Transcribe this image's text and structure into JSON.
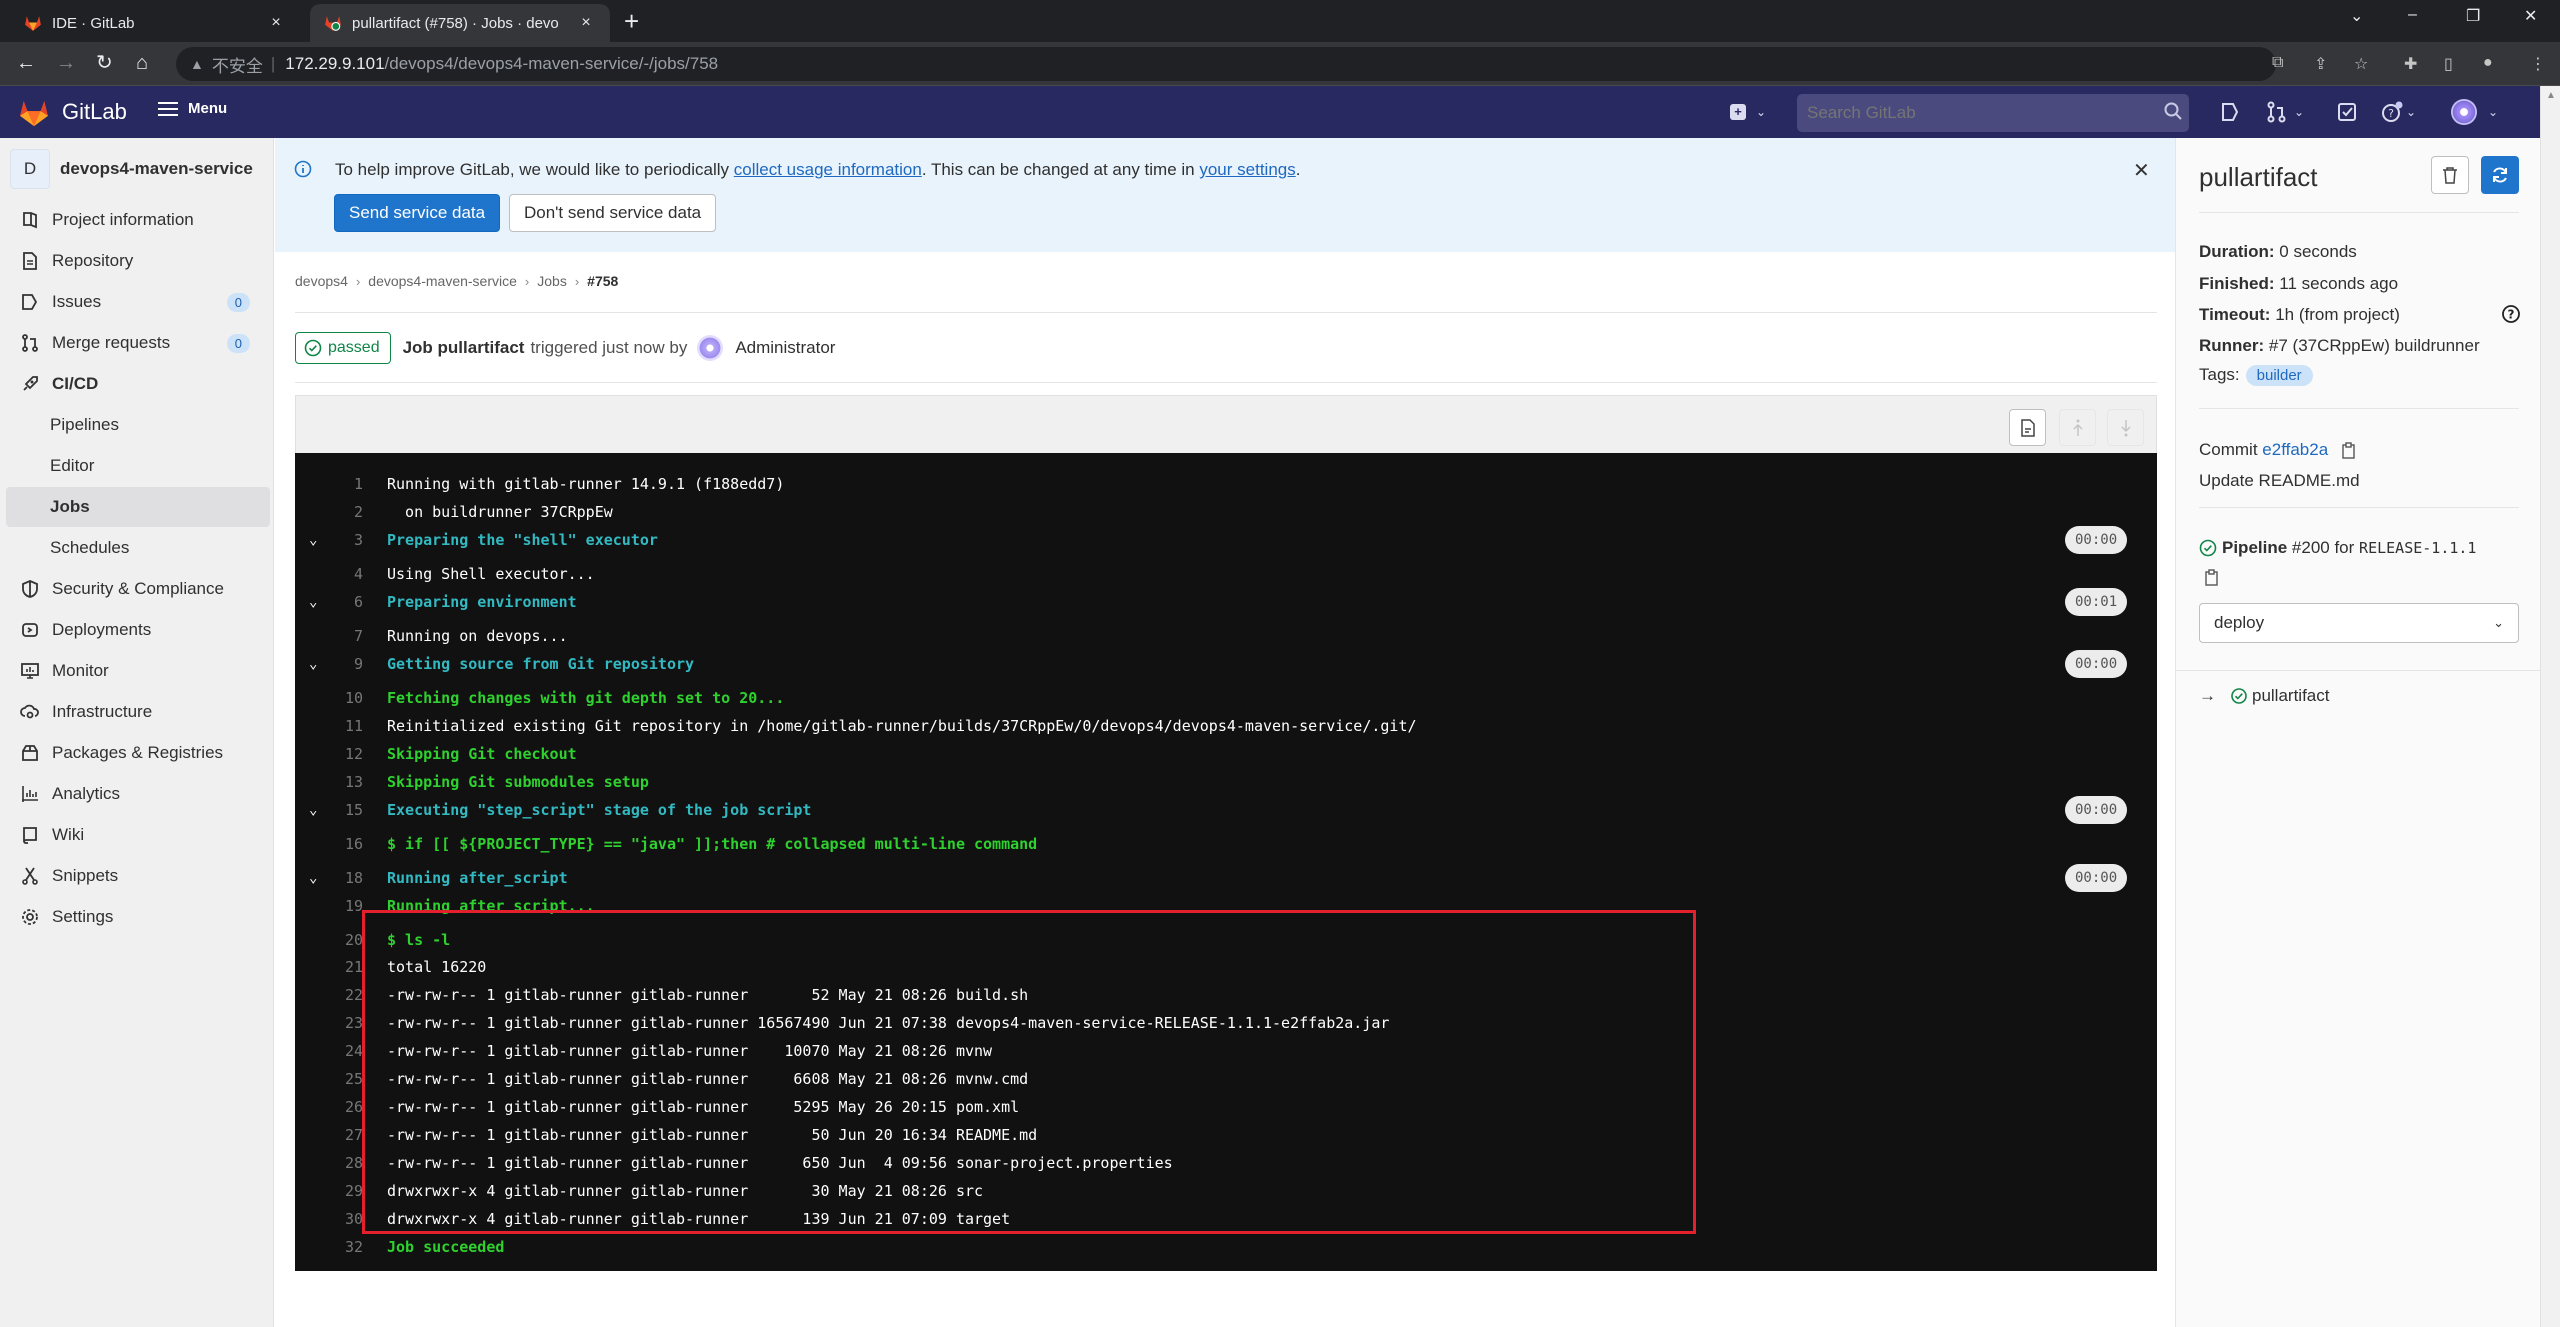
{
  "browser": {
    "tabs": [
      {
        "title": "IDE · GitLab",
        "active": false
      },
      {
        "title": "pullartifact (#758) · Jobs · devo",
        "active": true
      }
    ],
    "new_tab": "+",
    "close_glyph": "×",
    "window_controls": {
      "dropdown": "⌄",
      "minimize": "–",
      "restore": "❐",
      "close": "✕"
    },
    "address": {
      "security_label": "不安全",
      "host": "172.29.9.101",
      "path": "/devops4/devops4-maven-service/-/jobs/758"
    }
  },
  "header": {
    "brand": "GitLab",
    "menu_label": "Menu",
    "search_placeholder": "Search GitLab",
    "colors": {
      "bg": "#292961",
      "search_bg": "#4a4a7e"
    }
  },
  "sidebar": {
    "project_initial": "D",
    "project_name": "devops4-maven-service",
    "items": [
      {
        "label": "Project information",
        "icon": "project-icon"
      },
      {
        "label": "Repository",
        "icon": "document-icon"
      },
      {
        "label": "Issues",
        "icon": "issues-icon",
        "badge": "0"
      },
      {
        "label": "Merge requests",
        "icon": "merge-request-icon",
        "badge": "0"
      },
      {
        "label": "CI/CD",
        "icon": "rocket-icon",
        "section": true
      },
      {
        "label": "Pipelines",
        "sub": true
      },
      {
        "label": "Editor",
        "sub": true
      },
      {
        "label": "Jobs",
        "sub": true,
        "active": true
      },
      {
        "label": "Schedules",
        "sub": true
      },
      {
        "label": "Security & Compliance",
        "icon": "shield-icon"
      },
      {
        "label": "Deployments",
        "icon": "deployments-icon"
      },
      {
        "label": "Monitor",
        "icon": "monitor-icon"
      },
      {
        "label": "Infrastructure",
        "icon": "cloud-gear-icon"
      },
      {
        "label": "Packages & Registries",
        "icon": "package-icon"
      },
      {
        "label": "Analytics",
        "icon": "analytics-icon"
      },
      {
        "label": "Wiki",
        "icon": "book-icon"
      },
      {
        "label": "Snippets",
        "icon": "snippet-icon"
      },
      {
        "label": "Settings",
        "icon": "settings-icon"
      }
    ]
  },
  "banner": {
    "text_before": "To help improve GitLab, we would like to periodically ",
    "link1": "collect usage information",
    "text_middle": ". This can be changed at any time in ",
    "link2": "your settings",
    "text_after": ".",
    "send_button": "Send service data",
    "dont_send_button": "Don't send service data"
  },
  "breadcrumb": [
    "devops4",
    "devops4-maven-service",
    "Jobs",
    "#758"
  ],
  "job_header": {
    "status": "passed",
    "title_strong": "Job pullartifact",
    "triggered": "triggered just now by",
    "user": "Administrator"
  },
  "log": {
    "lines": [
      {
        "n": "1",
        "text": "Running with gitlab-runner 14.9.1 (f188edd7)",
        "style": "plain"
      },
      {
        "n": "2",
        "text": "  on buildrunner 37CRppEw",
        "style": "plain"
      },
      {
        "n": "3",
        "text": "Preparing the \"shell\" executor",
        "style": "cyan",
        "section": true,
        "duration": "00:00"
      },
      {
        "n": "4",
        "text": "Using Shell executor...",
        "style": "plain"
      },
      {
        "n": "6",
        "text": "Preparing environment",
        "style": "cyan",
        "section": true,
        "duration": "00:01"
      },
      {
        "n": "7",
        "text": "Running on devops...",
        "style": "plain"
      },
      {
        "n": "9",
        "text": "Getting source from Git repository",
        "style": "cyan",
        "section": true,
        "duration": "00:00"
      },
      {
        "n": "10",
        "text": "Fetching changes with git depth set to 20...",
        "style": "green"
      },
      {
        "n": "11",
        "text": "Reinitialized existing Git repository in /home/gitlab-runner/builds/37CRppEw/0/devops4/devops4-maven-service/.git/",
        "style": "plain"
      },
      {
        "n": "12",
        "text": "Skipping Git checkout",
        "style": "green"
      },
      {
        "n": "13",
        "text": "Skipping Git submodules setup",
        "style": "green"
      },
      {
        "n": "15",
        "text": "Executing \"step_script\" stage of the job script",
        "style": "cyan",
        "section": true,
        "duration": "00:00"
      },
      {
        "n": "16",
        "text": "$ if [[ ${PROJECT_TYPE} == \"java\" ]];then # collapsed multi-line command",
        "style": "green"
      },
      {
        "n": "18",
        "text": "Running after_script",
        "style": "cyan",
        "section": true,
        "duration": "00:00"
      },
      {
        "n": "19",
        "text": "Running after script...",
        "style": "green"
      },
      {
        "n": "20",
        "text": "$ ls -l",
        "style": "green"
      },
      {
        "n": "21",
        "text": "total 16220",
        "style": "plain"
      },
      {
        "n": "22",
        "text": "-rw-rw-r-- 1 gitlab-runner gitlab-runner       52 May 21 08:26 build.sh",
        "style": "plain"
      },
      {
        "n": "23",
        "text": "-rw-rw-r-- 1 gitlab-runner gitlab-runner 16567490 Jun 21 07:38 devops4-maven-service-RELEASE-1.1.1-e2ffab2a.jar",
        "style": "plain"
      },
      {
        "n": "24",
        "text": "-rw-rw-r-- 1 gitlab-runner gitlab-runner    10070 May 21 08:26 mvnw",
        "style": "plain"
      },
      {
        "n": "25",
        "text": "-rw-rw-r-- 1 gitlab-runner gitlab-runner     6608 May 21 08:26 mvnw.cmd",
        "style": "plain"
      },
      {
        "n": "26",
        "text": "-rw-rw-r-- 1 gitlab-runner gitlab-runner     5295 May 26 20:15 pom.xml",
        "style": "plain"
      },
      {
        "n": "27",
        "text": "-rw-rw-r-- 1 gitlab-runner gitlab-runner       50 Jun 20 16:34 README.md",
        "style": "plain"
      },
      {
        "n": "28",
        "text": "-rw-rw-r-- 1 gitlab-runner gitlab-runner      650 Jun  4 09:56 sonar-project.properties",
        "style": "plain"
      },
      {
        "n": "29",
        "text": "drwxrwxr-x 4 gitlab-runner gitlab-runner       30 May 21 08:26 src",
        "style": "plain"
      },
      {
        "n": "30",
        "text": "drwxrwxr-x 4 gitlab-runner gitlab-runner      139 Jun 21 07:09 target",
        "style": "plain"
      },
      {
        "n": "32",
        "text": "Job succeeded",
        "style": "green"
      }
    ],
    "highlight_color": "#e3202b"
  },
  "right_sidebar": {
    "title": "pullartifact",
    "duration_label": "Duration:",
    "duration": "0 seconds",
    "finished_label": "Finished:",
    "finished": "11 seconds ago",
    "timeout_label": "Timeout:",
    "timeout": "1h (from project)",
    "runner_label": "Runner:",
    "runner": "#7 (37CRppEw) buildrunner",
    "tags_label": "Tags:",
    "tags": [
      "builder"
    ],
    "commit_label": "Commit",
    "commit_sha": "e2ffab2a",
    "commit_message": "Update README.md",
    "pipeline_label": "Pipeline",
    "pipeline_text": "#200 for",
    "pipeline_ref": "RELEASE-1.1.1",
    "stage_select": "deploy",
    "current_job": "pullartifact",
    "arrow": "→"
  }
}
